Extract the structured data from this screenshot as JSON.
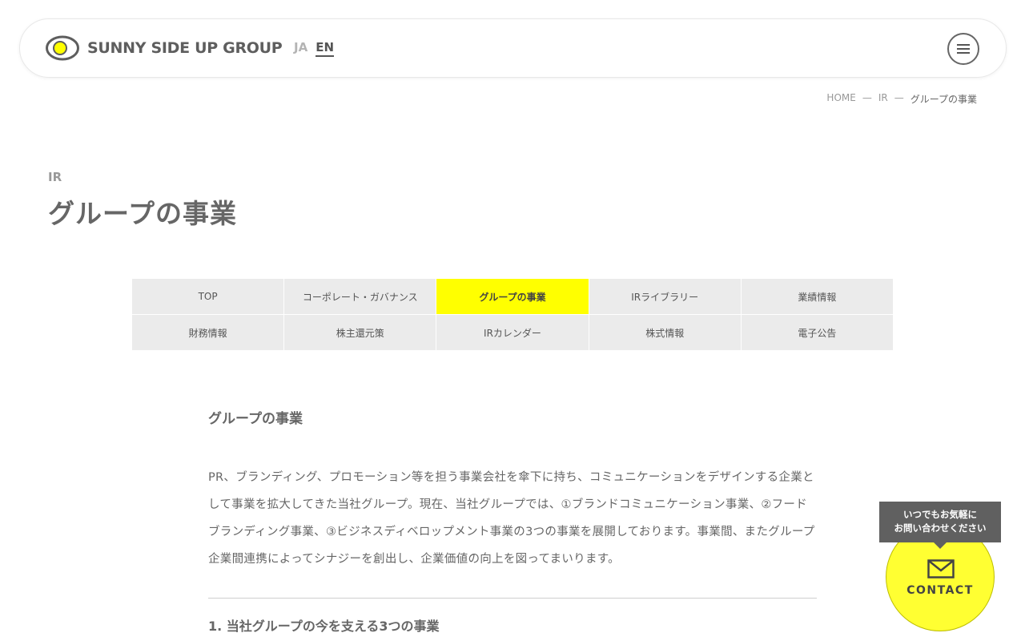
{
  "header": {
    "logo_text": "SUNNY SIDE UP GROUP",
    "lang_ja": "JA",
    "lang_en": "EN",
    "menu_icon": "hamburger-icon"
  },
  "breadcrumb": {
    "home": "HOME",
    "separator": "—",
    "ir": "IR",
    "current": "グループの事業"
  },
  "page": {
    "section_label": "IR",
    "title": "グループの事業"
  },
  "subnav": {
    "active_color": "#ffff00",
    "row1": [
      "TOP",
      "コーポレート・ガバナンス",
      "グループの事業",
      "IRライブラリー",
      "業績情報"
    ],
    "row2": [
      "財務情報",
      "株主還元策",
      "IRカレンダー",
      "株式情報",
      "電子公告"
    ],
    "active": "グループの事業"
  },
  "content": {
    "heading": "グループの事業",
    "paragraph": "PR、ブランディング、プロモーション等を担う事業会社を傘下に持ち、コミュニケーションをデザインする企業として事業を拡大してきた当社グループ。現在、当社グループでは、①ブランドコミュニケーション事業、②フードブランディング事業、③ビジネスディベロップメント事業の3つの事業を展開しております。事業間、またグループ企業間連携によってシナジーを創出し、企業価値の向上を図ってまいります。",
    "subheading": "1. 当社グループの今を支える3つの事業"
  },
  "contact": {
    "tooltip_line1": "いつでもお気軽に",
    "tooltip_line2": "お問い合わせください",
    "label": "CONTACT",
    "icon": "mail-icon",
    "color": "#ffff32"
  }
}
